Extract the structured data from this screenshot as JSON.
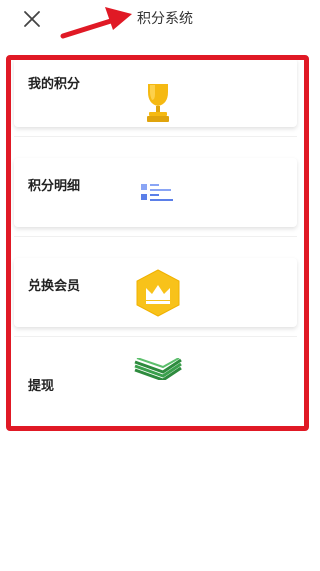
{
  "header": {
    "title": "积分系统"
  },
  "menu": {
    "items": [
      {
        "label": "我的积分",
        "icon": "trophy-icon"
      },
      {
        "label": "积分明细",
        "icon": "list-detail-icon"
      },
      {
        "label": "兑换会员",
        "icon": "crown-badge-icon"
      },
      {
        "label": "提现",
        "icon": "cash-stack-icon"
      }
    ]
  },
  "colors": {
    "highlight": "#e01925",
    "trophy": "#f5b912",
    "list": "#6b8ff2",
    "crown_bg": "#f8c21a",
    "cash": "#2e8b3e"
  }
}
